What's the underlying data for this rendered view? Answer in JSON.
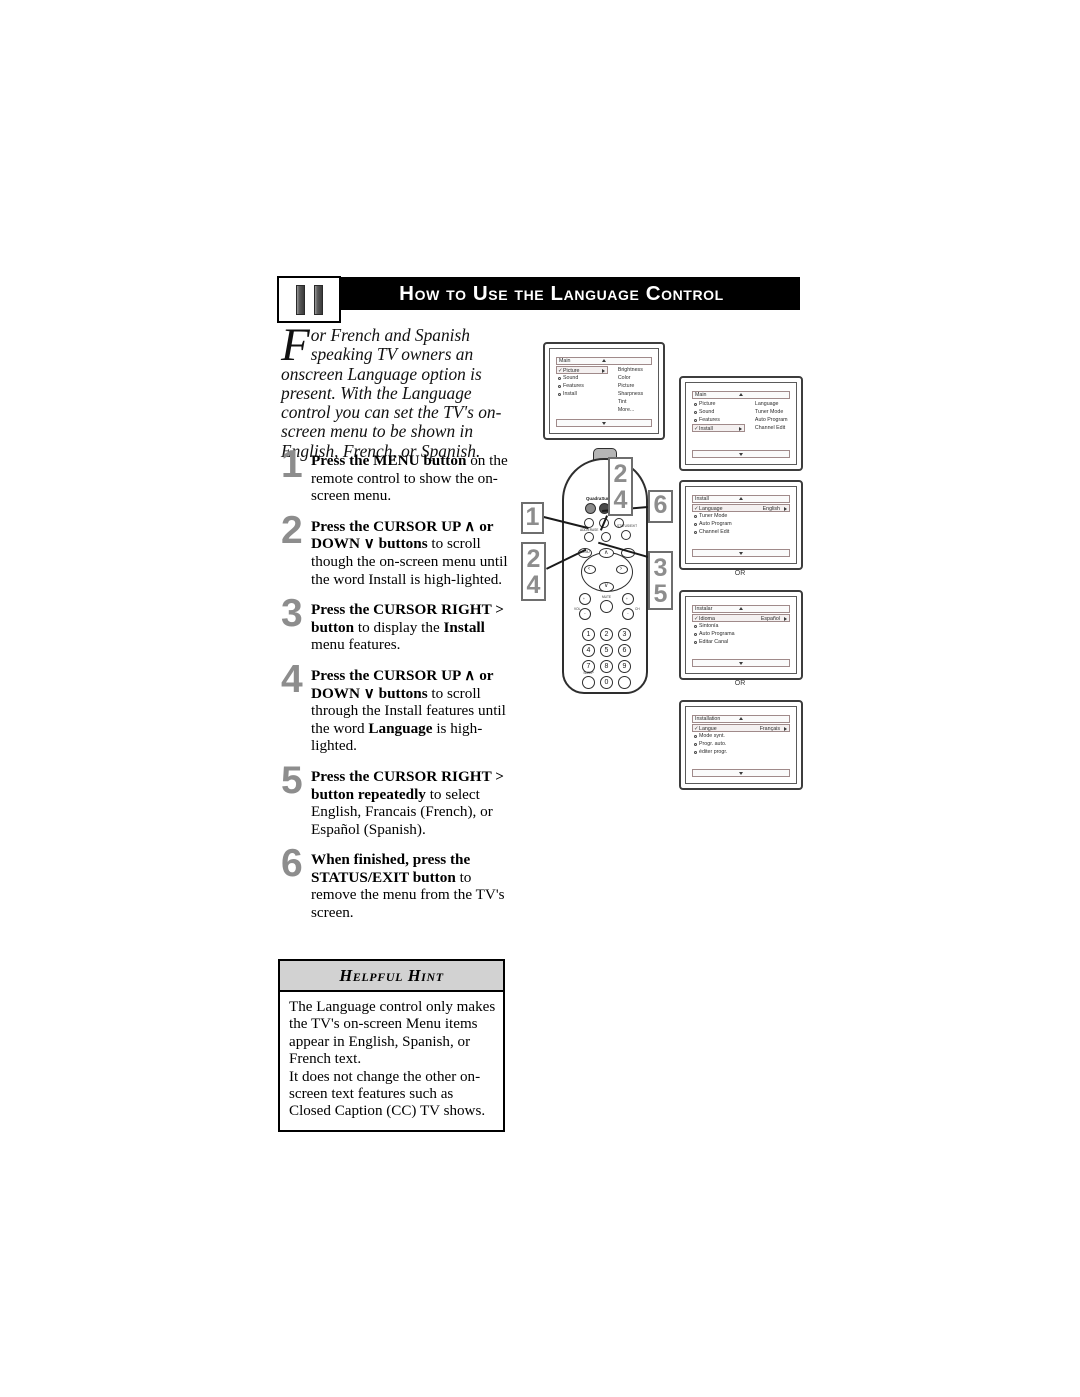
{
  "page": {
    "chapter_number": "11",
    "title": "How to Use the Language Control"
  },
  "intro": {
    "dropcap": "F",
    "text": "or French and Spanish speaking TV owners an onscreen Language option is present. With the Language control you can set the TV's on-screen menu to be shown in English, French, or Spanish."
  },
  "steps": [
    {
      "number": "1",
      "bold_lead": "Press the MENU button",
      "rest": " on the remote control to show the on-screen menu."
    },
    {
      "number": "2",
      "bold_lead": "Press the CURSOR UP ∧ or DOWN ∨ buttons",
      "rest": " to scroll though the on-screen menu until the word Install is high-lighted."
    },
    {
      "number": "3",
      "bold_lead": "Press the CURSOR RIGHT >  button",
      "rest": " to display the ",
      "bold_tail": "Install",
      "rest2": " menu features."
    },
    {
      "number": "4",
      "bold_lead": "Press the CURSOR UP ∧ or DOWN ∨ buttons",
      "rest": " to scroll through the Install features until the word ",
      "bold_tail": "Language",
      "rest2": " is high-lighted."
    },
    {
      "number": "5",
      "bold_lead": "Press the CURSOR RIGHT >  button repeatedly",
      "rest": " to select English, Francais (French), or Español (Spanish)."
    },
    {
      "number": "6",
      "bold_lead": "When finished, press the STATUS/EXIT button",
      "rest": " to remove the menu from the TV's screen."
    }
  ],
  "hint": {
    "title": "Helpful Hint",
    "paragraph1": "The Language control only makes the TV's on-screen Menu items appear in English, Spanish, or French text.",
    "paragraph2": "It does not change the other on-screen text features such as Closed Caption (CC) TV shows."
  },
  "screens": [
    {
      "id": "tv1",
      "menu_title": "Main",
      "left_items": [
        {
          "label": "Picture",
          "selected": true,
          "has_arrow": true
        },
        {
          "label": "Sound",
          "selected": false,
          "has_arrow": false
        },
        {
          "label": "Features",
          "selected": false,
          "has_arrow": false
        },
        {
          "label": "Install",
          "selected": false,
          "has_arrow": false
        }
      ],
      "right_items": [
        "Brightness",
        "Color",
        "Picture",
        "Sharpness",
        "Tint",
        "More..."
      ]
    },
    {
      "id": "tv2",
      "menu_title": "Main",
      "left_items": [
        {
          "label": "Picture",
          "selected": false,
          "has_arrow": false
        },
        {
          "label": "Sound",
          "selected": false,
          "has_arrow": false
        },
        {
          "label": "Features",
          "selected": false,
          "has_arrow": false
        },
        {
          "label": "Install",
          "selected": true,
          "has_arrow": true
        }
      ],
      "right_items": [
        "Language",
        "Tuner Mode",
        "Auto Program",
        "Channel Edit"
      ]
    },
    {
      "id": "tv3",
      "menu_title": "Install",
      "left_items": [
        {
          "label": "Language",
          "selected": true,
          "has_arrow": true,
          "value": "English"
        },
        {
          "label": "Tuner Mode",
          "selected": false,
          "has_arrow": false
        },
        {
          "label": "Auto Program",
          "selected": false,
          "has_arrow": false
        },
        {
          "label": "Channel Edit",
          "selected": false,
          "has_arrow": false
        }
      ],
      "right_items": []
    },
    {
      "id": "tv4",
      "menu_title": "Instalar",
      "left_items": [
        {
          "label": "Idioma",
          "selected": true,
          "has_arrow": true,
          "value": "Español"
        },
        {
          "label": "Sintonía",
          "selected": false,
          "has_arrow": false
        },
        {
          "label": "Auto Programa",
          "selected": false,
          "has_arrow": false
        },
        {
          "label": "Editar Canal",
          "selected": false,
          "has_arrow": false
        }
      ],
      "right_items": []
    },
    {
      "id": "tv5",
      "menu_title": "Installation",
      "left_items": [
        {
          "label": "Langue",
          "selected": true,
          "has_arrow": true,
          "value": "Français"
        },
        {
          "label": "Mode synt.",
          "selected": false,
          "has_arrow": false
        },
        {
          "label": "Progr. auto.",
          "selected": false,
          "has_arrow": false
        },
        {
          "label": "éditer progr.",
          "selected": false,
          "has_arrow": false
        }
      ],
      "right_items": []
    }
  ],
  "separators": {
    "or": "OR"
  },
  "remote": {
    "brand": "QuadraSurf™",
    "labels": {
      "power": "POWER",
      "menu": "MENU",
      "status_exit": "STATUS/EXIT",
      "ok": "OK",
      "mute": "MUTE",
      "sleep": "SLEEP",
      "ch": "CH",
      "vol": "VOL",
      "av": "AV",
      "cc": "CC",
      "surf": "SURF",
      "add_erase": "ADD/ERASE"
    },
    "keypad": [
      "1",
      "2",
      "3",
      "4",
      "5",
      "6",
      "7",
      "8",
      "9",
      "0"
    ],
    "cursor": {
      "up": "∧",
      "down": "∨",
      "left": "‹",
      "right": "›"
    }
  },
  "callouts": [
    {
      "id": "callout1",
      "text": "1"
    },
    {
      "id": "callout24a",
      "text": "2\n4"
    },
    {
      "id": "callout24b",
      "text": "2\n4"
    },
    {
      "id": "callout6",
      "text": "6"
    },
    {
      "id": "callout35",
      "text": "3\n5"
    }
  ],
  "colors": {
    "header_bar": "#000000",
    "header_text": "#ffffff",
    "step_number": "#8d8d8d",
    "hint_header_bg": "#d2d2d2",
    "page_bg": "#ffffff"
  }
}
